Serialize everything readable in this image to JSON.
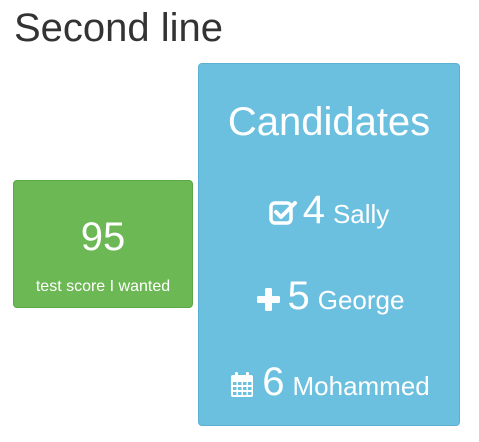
{
  "header": {
    "title": "Second line"
  },
  "score_tile": {
    "value": "95",
    "label": "test score I wanted",
    "color": "#6cb854"
  },
  "candidates": {
    "title": "Candidates",
    "color": "#6bbfdf",
    "items": [
      {
        "icon": "check-square-icon",
        "count": "4",
        "name": "Sally"
      },
      {
        "icon": "plus-icon",
        "count": "5",
        "name": "George"
      },
      {
        "icon": "calendar-icon",
        "count": "6",
        "name": "Mohammed"
      }
    ]
  }
}
